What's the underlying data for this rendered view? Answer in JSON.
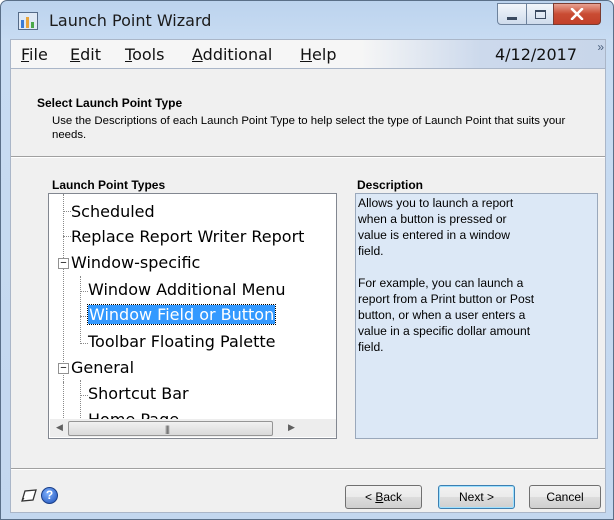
{
  "window": {
    "title": "Launch Point Wizard"
  },
  "menu": {
    "items": [
      {
        "label": "File",
        "u": "F",
        "rest": "ile"
      },
      {
        "label": "Edit",
        "u": "E",
        "rest": "dit"
      },
      {
        "label": "Tools",
        "u": "T",
        "rest": "ools"
      },
      {
        "label": "Additional",
        "u": "A",
        "rest": "dditional"
      },
      {
        "label": "Help",
        "u": "H",
        "rest": "elp"
      }
    ],
    "date": "4/12/2017",
    "overflow": "»"
  },
  "header": {
    "title": "Select Launch Point Type",
    "description": "Use the Descriptions of each Launch Point Type to help select the type of Launch Point that suits your needs."
  },
  "tree": {
    "label": "Launch Point Types",
    "items": [
      {
        "label": "Scheduled"
      },
      {
        "label": "Replace Report Writer Report"
      },
      {
        "label": "Window-specific",
        "expander": "−"
      },
      {
        "label": "Window Additional Menu"
      },
      {
        "label": "Window Field or Button",
        "selected": true
      },
      {
        "label": "Toolbar Floating Palette"
      },
      {
        "label": "General",
        "expander": "−"
      },
      {
        "label": "Shortcut Bar"
      },
      {
        "label": "Home Page"
      }
    ]
  },
  "description": {
    "label": "Description",
    "text": "Allows you to launch a report\nwhen a button is pressed or\nvalue is entered in a window\nfield.\n\nFor example, you can launch a\nreport from a Print button or Post\nbutton, or when a user enters a\nvalue in a specific dollar amount\nfield."
  },
  "buttons": {
    "back": {
      "u": "B",
      "pre": "< ",
      "rest": "ack"
    },
    "next": {
      "label": "Next >"
    },
    "cancel": {
      "label": "Cancel"
    }
  },
  "icons": {
    "note": "note-icon",
    "help": "help-icon"
  },
  "colors": {
    "selection": "#3399ff",
    "description_bg": "#dce8f6",
    "close_button": "#c94c33"
  }
}
